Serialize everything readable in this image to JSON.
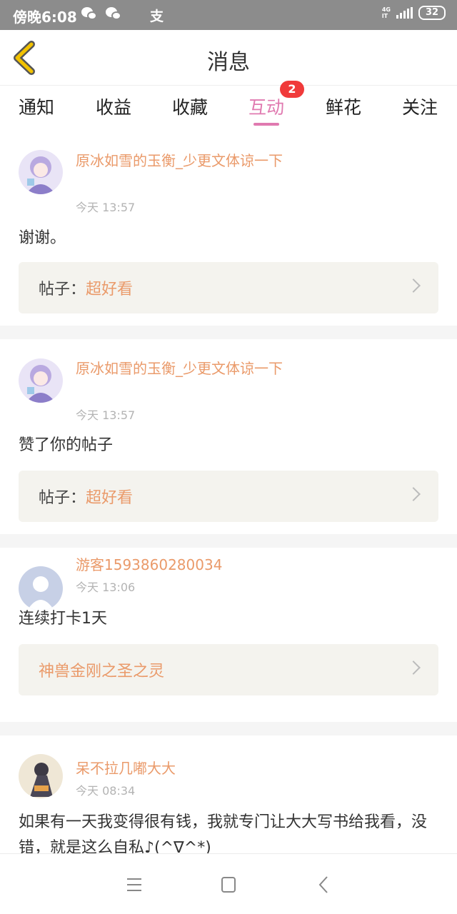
{
  "status_bar": {
    "time": "傍晚6:08",
    "alipay_glyph": "支",
    "network_top": "4G",
    "network_bottom": "lT",
    "battery": "32",
    "icons": [
      "wechat-icon",
      "wechat-icon",
      "alipay-icon",
      "signal-icon",
      "battery-icon"
    ]
  },
  "header": {
    "title": "消息",
    "back_icon": "chevron-left-icon",
    "accent_color": "#f2c200"
  },
  "tabs": {
    "items": [
      {
        "label": "通知"
      },
      {
        "label": "收益"
      },
      {
        "label": "收藏"
      },
      {
        "label": "互动",
        "active": true,
        "badge": "2"
      },
      {
        "label": "鲜花"
      },
      {
        "label": "关注"
      }
    ],
    "active_color": "#e07ab0",
    "badge_color": "#f03a3a"
  },
  "messages": [
    {
      "user": "原冰如雪的玉衡_少更文体谅一下",
      "time": "今天 13:57",
      "content": "谢谢。",
      "link_label": "帖子：",
      "link_value": "超好看"
    },
    {
      "user": "原冰如雪的玉衡_少更文体谅一下",
      "time": "今天 13:57",
      "content": "赞了你的帖子",
      "link_label": "帖子：",
      "link_value": "超好看"
    },
    {
      "user": "游客1593860280034",
      "time": "今天 13:06",
      "content": "连续打卡1天",
      "link_label": "",
      "link_value": "神兽金刚之圣之灵"
    },
    {
      "user": "呆不拉几嘟大大",
      "time": "今天 08:34",
      "content": "如果有一天我变得很有钱，我就专门让大大写书给我看，没错，就是这么自私♪(^∇^*)"
    }
  ],
  "colors": {
    "username": "#ea9a6a",
    "link_bg": "#f4f3ee",
    "separator": "#f5f5f5"
  },
  "navbar": {
    "icons": [
      "menu-icon",
      "home-square-icon",
      "back-triangle-icon"
    ]
  }
}
